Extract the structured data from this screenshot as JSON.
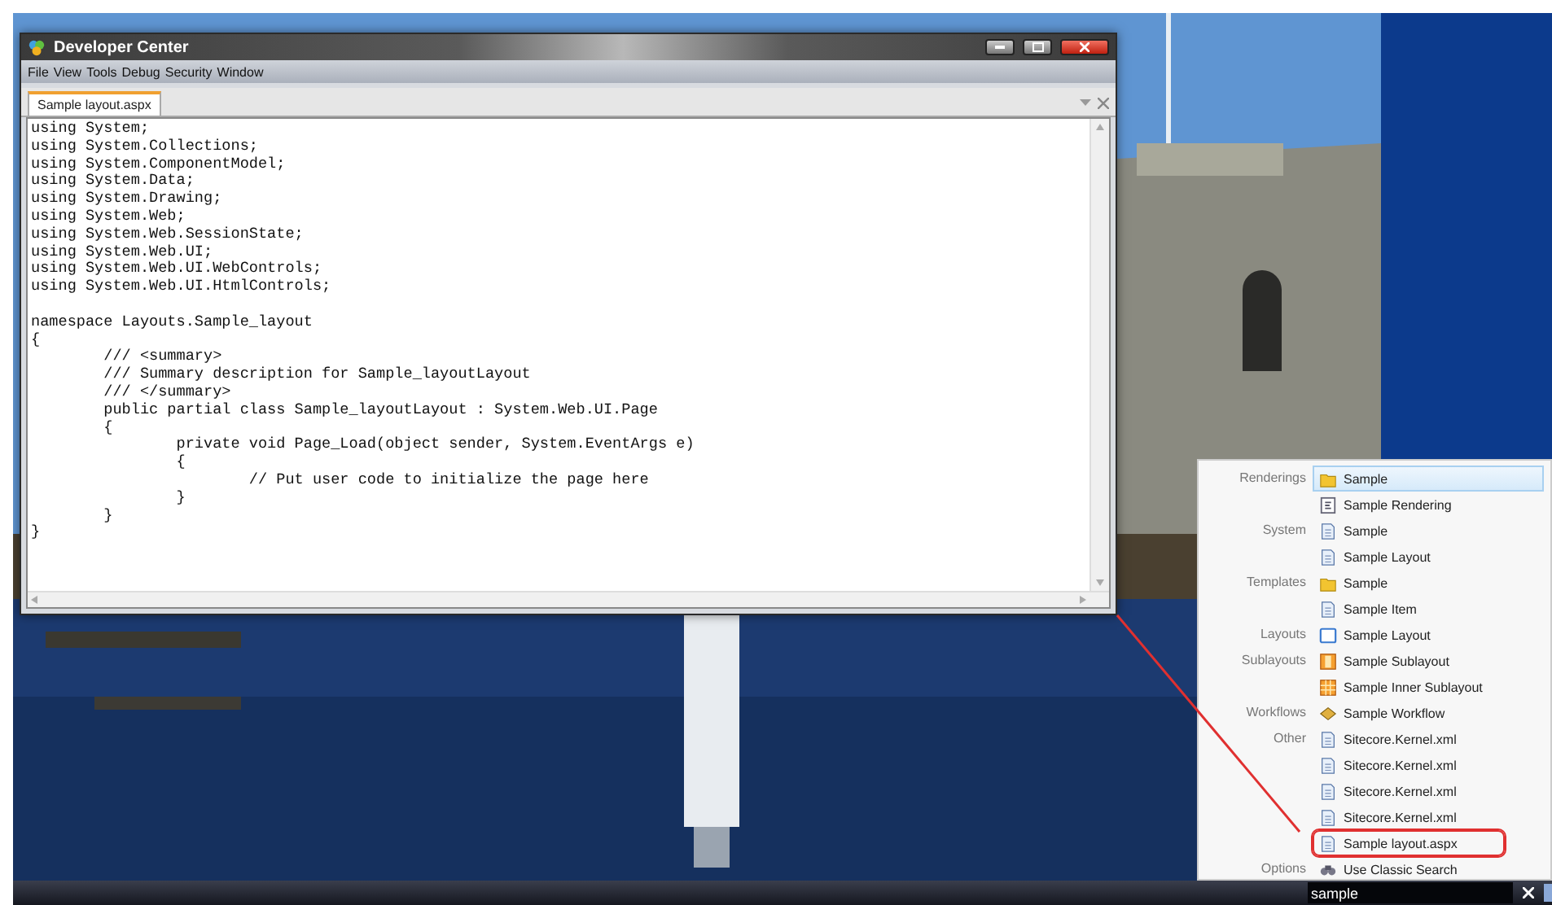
{
  "window": {
    "title": "Developer Center",
    "menu": [
      "File",
      "View",
      "Tools",
      "Debug",
      "Security",
      "Window"
    ],
    "tabs": [
      {
        "label": "Sample layout.aspx",
        "selected": true
      }
    ],
    "editor": {
      "blocks": [
        [
          "using System;",
          "using System.Collections;",
          "using System.ComponentModel;",
          "using System.Data;",
          "using System.Drawing;",
          "using System.Web;",
          "using System.Web.SessionState;",
          "using System.Web.UI;",
          "using System.Web.UI.WebControls;",
          "using System.Web.UI.HtmlControls;"
        ],
        [
          "namespace Layouts.Sample_layout",
          "{",
          "        /// <summary>",
          "        /// Summary description for Sample_layoutLayout",
          "        /// </summary>",
          "        public partial class Sample_layoutLayout : System.Web.UI.Page",
          "        {",
          "                private void Page_Load(object sender, System.EventArgs e)",
          "                {",
          "                        // Put user code to initialize the page here",
          "                }",
          "        }",
          "}"
        ]
      ]
    }
  },
  "search_results": {
    "groups": [
      {
        "category": "Renderings",
        "items": [
          {
            "label": "Sample",
            "kind": "folder",
            "selected": true,
            "circled": false
          },
          {
            "label": "Sample Rendering",
            "kind": "rendering",
            "selected": false,
            "circled": false
          }
        ]
      },
      {
        "category": "System",
        "items": [
          {
            "label": "Sample",
            "kind": "document",
            "selected": false,
            "circled": false
          },
          {
            "label": "Sample Layout",
            "kind": "document",
            "selected": false,
            "circled": false
          }
        ]
      },
      {
        "category": "Templates",
        "items": [
          {
            "label": "Sample",
            "kind": "folder",
            "selected": false,
            "circled": false
          },
          {
            "label": "Sample Item",
            "kind": "document",
            "selected": false,
            "circled": false
          }
        ]
      },
      {
        "category": "Layouts",
        "items": [
          {
            "label": "Sample Layout",
            "kind": "layout",
            "selected": false,
            "circled": false
          }
        ]
      },
      {
        "category": "Sublayouts",
        "items": [
          {
            "label": "Sample Sublayout",
            "kind": "sublayout",
            "selected": false,
            "circled": false
          },
          {
            "label": "Sample Inner Sublayout",
            "kind": "grid",
            "selected": false,
            "circled": false
          }
        ]
      },
      {
        "category": "Workflows",
        "items": [
          {
            "label": "Sample Workflow",
            "kind": "workflow",
            "selected": false,
            "circled": false
          }
        ]
      },
      {
        "category": "Other",
        "items": [
          {
            "label": "Sitecore.Kernel.xml",
            "kind": "document",
            "selected": false,
            "circled": false
          },
          {
            "label": "Sitecore.Kernel.xml",
            "kind": "document",
            "selected": false,
            "circled": false
          },
          {
            "label": "Sitecore.Kernel.xml",
            "kind": "document",
            "selected": false,
            "circled": false
          },
          {
            "label": "Sitecore.Kernel.xml",
            "kind": "document",
            "selected": false,
            "circled": false
          },
          {
            "label": "Sample layout.aspx",
            "kind": "document",
            "selected": false,
            "circled": true
          }
        ]
      },
      {
        "category": "Options",
        "items": [
          {
            "label": "Use Classic Search",
            "kind": "binoculars",
            "selected": false,
            "circled": false
          }
        ]
      }
    ]
  },
  "taskbar": {
    "search": {
      "value": "sample"
    }
  }
}
